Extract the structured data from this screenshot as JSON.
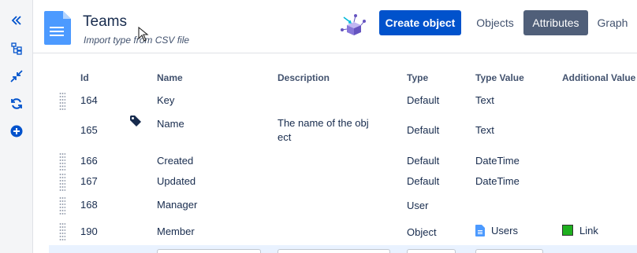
{
  "sidebar": {
    "buttons": [
      {
        "icon": "double-chevron-left-icon"
      },
      {
        "icon": "hierarchy-icon"
      },
      {
        "icon": "collapse-icon"
      },
      {
        "icon": "refresh-icon"
      },
      {
        "icon": "add-icon"
      }
    ]
  },
  "header": {
    "title": "Teams",
    "subtitle": "Import type from CSV file",
    "create_label": "Create object",
    "tabs": [
      {
        "label": "Objects",
        "active": false
      },
      {
        "label": "Attributes",
        "active": true
      },
      {
        "label": "Graph",
        "active": false
      }
    ]
  },
  "table": {
    "columns": [
      "Id",
      "Name",
      "Description",
      "Type",
      "Type Value",
      "Additional Value"
    ],
    "rows": [
      {
        "id": "164",
        "name": "Key",
        "description": "",
        "type": "Default",
        "type_value": "Text",
        "additional": ""
      },
      {
        "id": "165",
        "name": "Name",
        "description": "The name of the obj ect",
        "type": "Default",
        "type_value": "Text",
        "additional": "",
        "label_icon": "tag-icon"
      },
      {
        "id": "166",
        "name": "Created",
        "description": "",
        "type": "Default",
        "type_value": "DateTime",
        "additional": ""
      },
      {
        "id": "167",
        "name": "Updated",
        "description": "",
        "type": "Default",
        "type_value": "DateTime",
        "additional": ""
      },
      {
        "id": "168",
        "name": "Manager",
        "description": "",
        "type": "User",
        "type_value": "",
        "additional": ""
      },
      {
        "id": "190",
        "name": "Member",
        "description": "",
        "type": "Object",
        "type_value": "Users",
        "additional": "Link",
        "type_value_icon": "document-icon",
        "additional_color": "#1fb01f"
      }
    ]
  },
  "colors": {
    "primary": "#0052cc",
    "active_tab": "#505f79",
    "link_swatch": "#1fb01f"
  }
}
